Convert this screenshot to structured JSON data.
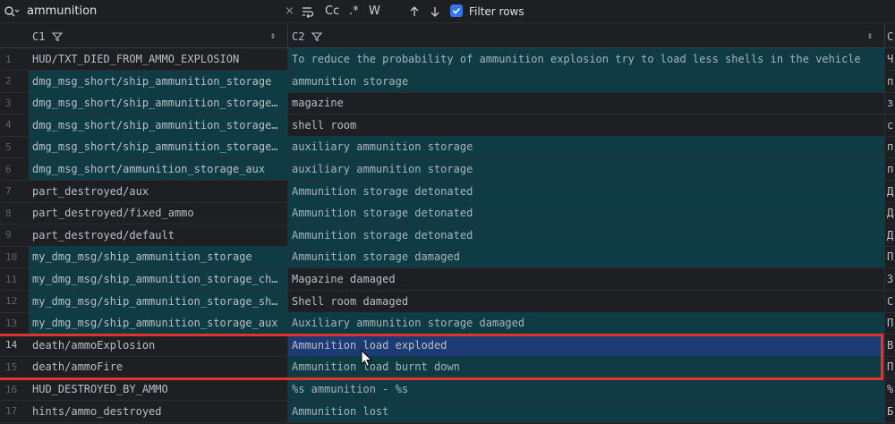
{
  "search": {
    "query": "ammunition",
    "clear_icon": "×",
    "regex_label": ".*",
    "case_label": "Cc",
    "word_label": "W",
    "filter_rows_label": "Filter rows",
    "filter_rows_checked": true
  },
  "columns": [
    {
      "name": "C1"
    },
    {
      "name": "C2"
    },
    {
      "name": "C"
    }
  ],
  "rows": [
    {
      "num": "1",
      "c1": "HUD/TXT_DIED_FROM_AMMO_EXPLOSION",
      "c2": "To reduce the probability of ammunition explosion try to load less shells in the vehicle",
      "c3": "Ч",
      "hl1": false,
      "hl2": true
    },
    {
      "num": "2",
      "c1": "dmg_msg_short/ship_ammunition_storage",
      "c2": "ammunition storage",
      "c3": "п",
      "hl1": true,
      "hl2": true
    },
    {
      "num": "3",
      "c1": "dmg_msg_short/ship_ammunition_storage…",
      "c2": "magazine",
      "c3": "з",
      "hl1": true,
      "hl2": false
    },
    {
      "num": "4",
      "c1": "dmg_msg_short/ship_ammunition_storage…",
      "c2": "shell room",
      "c3": "с",
      "hl1": true,
      "hl2": false
    },
    {
      "num": "5",
      "c1": "dmg_msg_short/ship_ammunition_storage…",
      "c2": "auxiliary ammunition storage",
      "c3": "п",
      "hl1": true,
      "hl2": true
    },
    {
      "num": "6",
      "c1": "dmg_msg_short/ammunition_storage_aux",
      "c2": "auxiliary ammunition storage",
      "c3": "п",
      "hl1": true,
      "hl2": true
    },
    {
      "num": "7",
      "c1": "part_destroyed/aux",
      "c2": "Ammunition storage detonated",
      "c3": "Д",
      "hl1": false,
      "hl2": true
    },
    {
      "num": "8",
      "c1": "part_destroyed/fixed_ammo",
      "c2": "Ammunition storage detonated",
      "c3": "Д",
      "hl1": false,
      "hl2": true
    },
    {
      "num": "9",
      "c1": "part_destroyed/default",
      "c2": "Ammunition storage detonated",
      "c3": "Д",
      "hl1": false,
      "hl2": true
    },
    {
      "num": "10",
      "c1": "my_dmg_msg/ship_ammunition_storage",
      "c2": "Ammunition storage damaged",
      "c3": "П",
      "hl1": true,
      "hl2": true
    },
    {
      "num": "11",
      "c1": "my_dmg_msg/ship_ammunition_storage_ch…",
      "c2": "Magazine damaged",
      "c3": "З",
      "hl1": true,
      "hl2": false
    },
    {
      "num": "12",
      "c1": "my_dmg_msg/ship_ammunition_storage_sh…",
      "c2": "Shell room damaged",
      "c3": "С",
      "hl1": true,
      "hl2": false
    },
    {
      "num": "13",
      "c1": "my_dmg_msg/ship_ammunition_storage_aux",
      "c2": "Auxiliary ammunition storage damaged",
      "c3": "П",
      "hl1": true,
      "hl2": true
    },
    {
      "num": "14",
      "c1": "death/ammoExplosion",
      "c2": "Ammunition load exploded",
      "c3": "В",
      "hl1": false,
      "hl2": true,
      "selected": true
    },
    {
      "num": "15",
      "c1": "death/ammoFire",
      "c2": "Ammunition load burnt down",
      "c3": "П",
      "hl1": false,
      "hl2": true
    },
    {
      "num": "16",
      "c1": "HUD_DESTROYED_BY_AMMO",
      "c2": "%s ammunition - %s",
      "c3": "%",
      "hl1": false,
      "hl2": true
    },
    {
      "num": "17",
      "c1": "hints/ammo_destroyed",
      "c2": "Ammunition lost",
      "c3": "Б",
      "hl1": false,
      "hl2": true
    }
  ],
  "colors": {
    "match_highlight": "#0f3b45",
    "selection": "#1c3a74",
    "annotation_box": "#e0342f",
    "checkbox_accent": "#3574f0"
  }
}
